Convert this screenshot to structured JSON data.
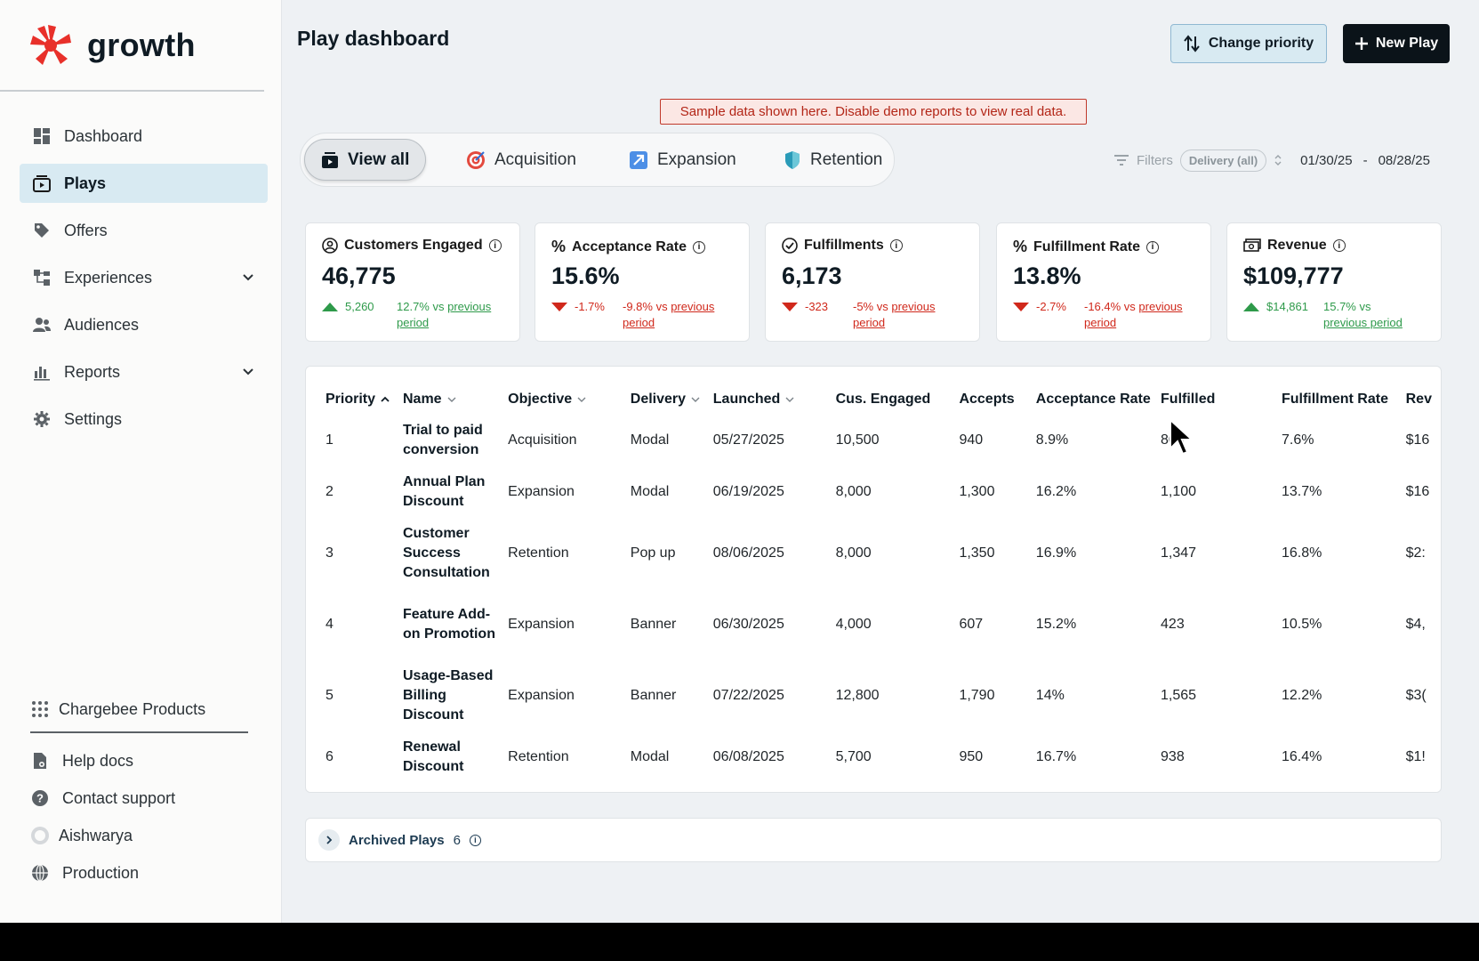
{
  "brand": {
    "name": "growth"
  },
  "sidebar": {
    "items": [
      {
        "label": "Dashboard",
        "icon": "dashboard-icon"
      },
      {
        "label": "Plays",
        "icon": "plays-icon",
        "active": true
      },
      {
        "label": "Offers",
        "icon": "tag-icon"
      },
      {
        "label": "Experiences",
        "icon": "experiences-icon",
        "expandable": true
      },
      {
        "label": "Audiences",
        "icon": "audiences-icon"
      },
      {
        "label": "Reports",
        "icon": "reports-icon",
        "expandable": true
      },
      {
        "label": "Settings",
        "icon": "gear-icon"
      }
    ],
    "bottom": {
      "products": "Chargebee Products",
      "help": "Help docs",
      "support": "Contact support",
      "user": "Aishwarya",
      "env": "Production"
    }
  },
  "header": {
    "title": "Play dashboard",
    "change_priority": "Change priority",
    "new_play": "New Play",
    "banner": "Sample data shown here. Disable demo reports to view real data."
  },
  "tabs": [
    {
      "label": "View all"
    },
    {
      "label": "Acquisition"
    },
    {
      "label": "Expansion"
    },
    {
      "label": "Retention"
    }
  ],
  "filters": {
    "label": "Filters",
    "delivery": "Delivery (all)",
    "date_from": "01/30/25",
    "date_sep": "-",
    "date_to": "08/28/25"
  },
  "kpis": [
    {
      "title": "Customers Engaged",
      "value": "46,775",
      "delta": "5,260",
      "pct": "12.7% vs ",
      "link1": "previous",
      "link2": "period",
      "trend": "up"
    },
    {
      "title": "Acceptance Rate",
      "value": "15.6%",
      "delta": "-1.7%",
      "pct": "-9.8% vs ",
      "link1": "previous",
      "link2": "period",
      "trend": "down"
    },
    {
      "title": "Fulfillments",
      "value": "6,173",
      "delta": "-323",
      "pct": "-5% vs ",
      "link1": "previous",
      "link2": "period",
      "trend": "down"
    },
    {
      "title": "Fulfillment Rate",
      "value": "13.8%",
      "delta": "-2.7%",
      "pct": "-16.4% vs ",
      "link1": "previous",
      "link2": "period",
      "trend": "down"
    },
    {
      "title": "Revenue",
      "value": "$109,777",
      "delta": "$14,861",
      "pct": "15.7% vs",
      "link1": "",
      "link2": "previous period",
      "trend": "up"
    }
  ],
  "table": {
    "columns": [
      "Priority",
      "Name",
      "Objective",
      "Delivery",
      "Launched",
      "Cus. Engaged",
      "Accepts",
      "Acceptance Rate",
      "Fulfilled",
      "Fulfillment Rate",
      "Rev"
    ],
    "rows": [
      {
        "priority": "1",
        "name": "Trial to paid conversion",
        "objective": "Acquisition",
        "delivery": "Modal",
        "launched": "05/27/2025",
        "engaged": "10,500",
        "accepts": "940",
        "acc_rate": "8.9%",
        "fulfilled": "800",
        "ful_rate": "7.6%",
        "rev": "$16"
      },
      {
        "priority": "2",
        "name": "Annual Plan Discount",
        "objective": "Expansion",
        "delivery": "Modal",
        "launched": "06/19/2025",
        "engaged": "8,000",
        "accepts": "1,300",
        "acc_rate": "16.2%",
        "fulfilled": "1,100",
        "ful_rate": "13.7%",
        "rev": "$16"
      },
      {
        "priority": "3",
        "name": "Customer Success Consultation",
        "objective": "Retention",
        "delivery": "Pop up",
        "launched": "08/06/2025",
        "engaged": "8,000",
        "accepts": "1,350",
        "acc_rate": "16.9%",
        "fulfilled": "1,347",
        "ful_rate": "16.8%",
        "rev": "$2:"
      },
      {
        "priority": "4",
        "name": "Feature Add-on Promotion",
        "objective": "Expansion",
        "delivery": "Banner",
        "launched": "06/30/2025",
        "engaged": "4,000",
        "accepts": "607",
        "acc_rate": "15.2%",
        "fulfilled": "423",
        "ful_rate": "10.5%",
        "rev": "$4,"
      },
      {
        "priority": "5",
        "name": "Usage-Based Billing Discount",
        "objective": "Expansion",
        "delivery": "Banner",
        "launched": "07/22/2025",
        "engaged": "12,800",
        "accepts": "1,790",
        "acc_rate": "14%",
        "fulfilled": "1,565",
        "ful_rate": "12.2%",
        "rev": "$3("
      },
      {
        "priority": "6",
        "name": "Renewal Discount",
        "objective": "Retention",
        "delivery": "Modal",
        "launched": "06/08/2025",
        "engaged": "5,700",
        "accepts": "950",
        "acc_rate": "16.7%",
        "fulfilled": "938",
        "ful_rate": "16.4%",
        "rev": "$1!"
      }
    ]
  },
  "archived": {
    "label": "Archived Plays",
    "count": "6"
  },
  "colors": {
    "accent": "#d8eaf2",
    "brand": "#e8302a",
    "up": "#2e9a4a",
    "down": "#d0281b"
  }
}
